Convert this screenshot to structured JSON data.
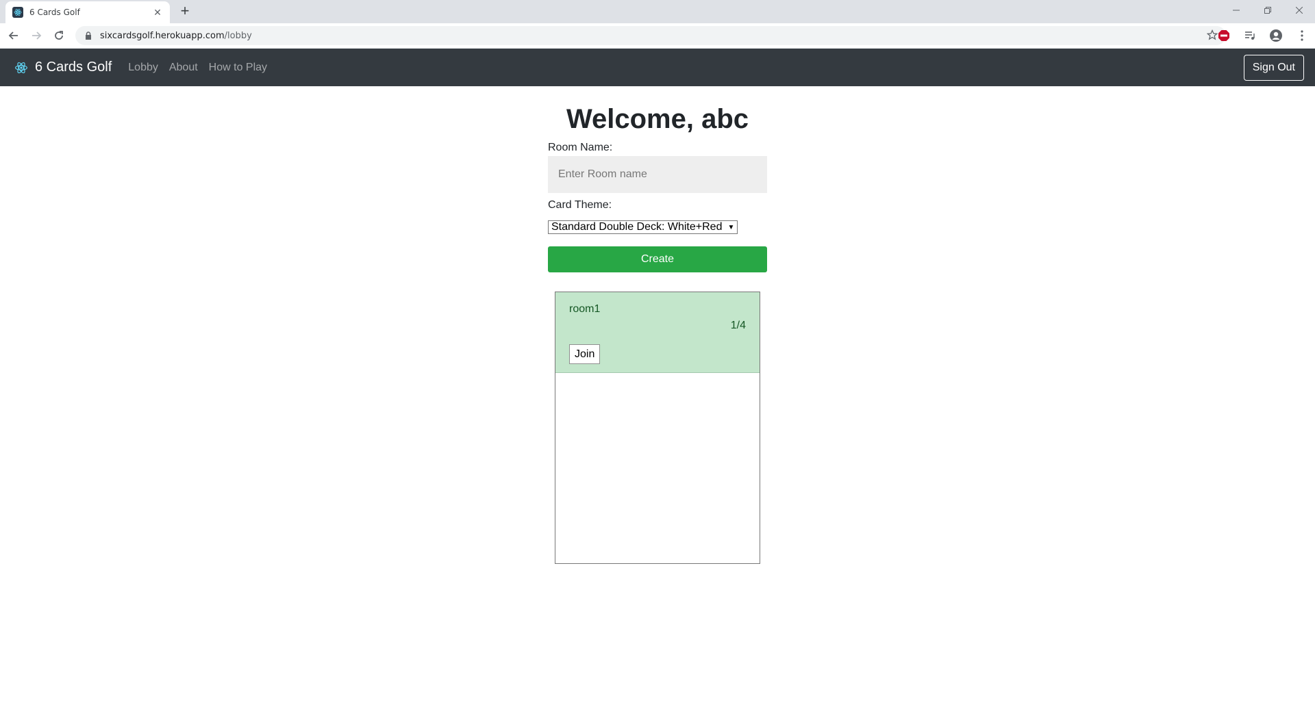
{
  "browser": {
    "tab_title": "6 Cards Golf",
    "url_host": "sixcardsgolf.herokuapp.com",
    "url_path": "/lobby",
    "new_tab": "+",
    "close_tab": "✕"
  },
  "navbar": {
    "brand": "6 Cards Golf",
    "links": [
      "Lobby",
      "About",
      "How to Play"
    ],
    "sign_out": "Sign Out"
  },
  "main": {
    "welcome": "Welcome, abc",
    "room_name_label": "Room Name:",
    "room_name_placeholder": "Enter Room name",
    "card_theme_label": "Card Theme:",
    "card_theme_selected": "Standard Double Deck: White+Red",
    "create_label": "Create"
  },
  "rooms": [
    {
      "name": "room1",
      "players": "1/4",
      "join_label": "Join"
    }
  ],
  "colors": {
    "navbar": "#343a40",
    "create_button": "#28a745",
    "room_card": "#c3e6cb"
  }
}
